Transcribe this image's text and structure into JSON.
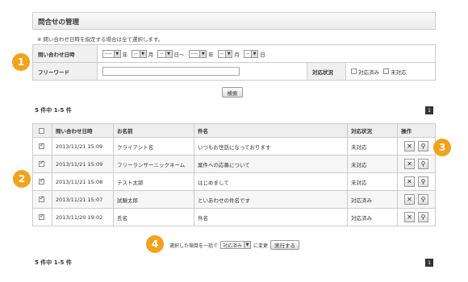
{
  "header": {
    "title": "問合せの管理"
  },
  "note": "※ 問い合わせ日時を指定する場合は全て選択します。",
  "filter": {
    "date_label": "問い合わせ日時",
    "placeholder": "----",
    "blank": "--",
    "year": "年",
    "month": "月",
    "day": "日",
    "tilde": "日～",
    "free_label": "フリーワード",
    "status_label": "対応状況",
    "status_options": [
      "対応済み",
      "未対応"
    ]
  },
  "search_label": "検索",
  "result_count": "5 件中 1-5 件",
  "page": "1",
  "table": {
    "headers": [
      "問い合わせ日時",
      "お名前",
      "件名",
      "対応状況",
      "操作"
    ],
    "rows": [
      {
        "date": "2013/11/21 15:09",
        "name": "クライアント名",
        "subject": "いつもお世話になっております",
        "status": "未対応"
      },
      {
        "date": "2013/11/21 15:09",
        "name": "フリーランサーニックネーム",
        "subject": "案件への応募について",
        "status": "未対応"
      },
      {
        "date": "2013/11/21 15:08",
        "name": "テスト太郎",
        "subject": "はじめまして",
        "status": "未対応"
      },
      {
        "date": "2013/11/21 15:07",
        "name": "試験太郎",
        "subject": "といあわせの件名です",
        "status": "対応済み"
      },
      {
        "date": "2013/11/20 19:02",
        "name": "氏名",
        "subject": "件名",
        "status": "対応済み"
      }
    ]
  },
  "bulk": {
    "prefix": "選択した項目を一括で",
    "select_value": "対応済み",
    "suffix": "に変更",
    "execute": "実行する"
  },
  "badges": [
    "1",
    "2",
    "3",
    "4"
  ],
  "icons": {
    "delete": "close-icon",
    "view": "search-icon"
  },
  "colors": {
    "badge": "#f2a21b"
  }
}
